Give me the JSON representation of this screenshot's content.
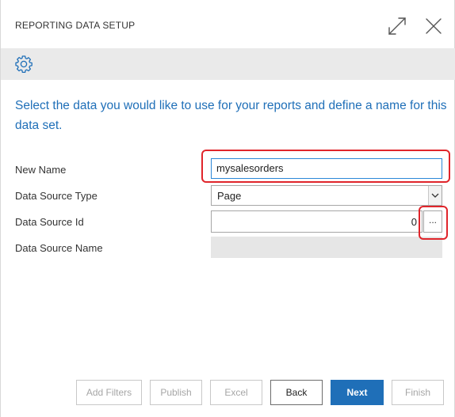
{
  "dialog": {
    "title": "REPORTING DATA SETUP",
    "icons": {
      "expand": "expand-icon",
      "close": "close-icon",
      "settings": "gear-icon"
    }
  },
  "instructions": "Select the data you would like to use for your reports and define a name for this data set.",
  "fields": {
    "new_name": {
      "label": "New Name",
      "value": "mysalesorders"
    },
    "data_source_type": {
      "label": "Data Source Type",
      "value": "Page"
    },
    "data_source_id": {
      "label": "Data Source Id",
      "value": "0",
      "lookup_label": "..."
    },
    "data_source_name": {
      "label": "Data Source Name",
      "value": ""
    }
  },
  "buttons": {
    "add_filters": "Add Filters",
    "publish": "Publish",
    "excel": "Excel",
    "back": "Back",
    "next": "Next",
    "finish": "Finish"
  },
  "colors": {
    "accent": "#1f6fb8",
    "highlight": "#e0252b",
    "toolbar": "#eaeaea",
    "readonly_field": "#e6e6e6"
  }
}
